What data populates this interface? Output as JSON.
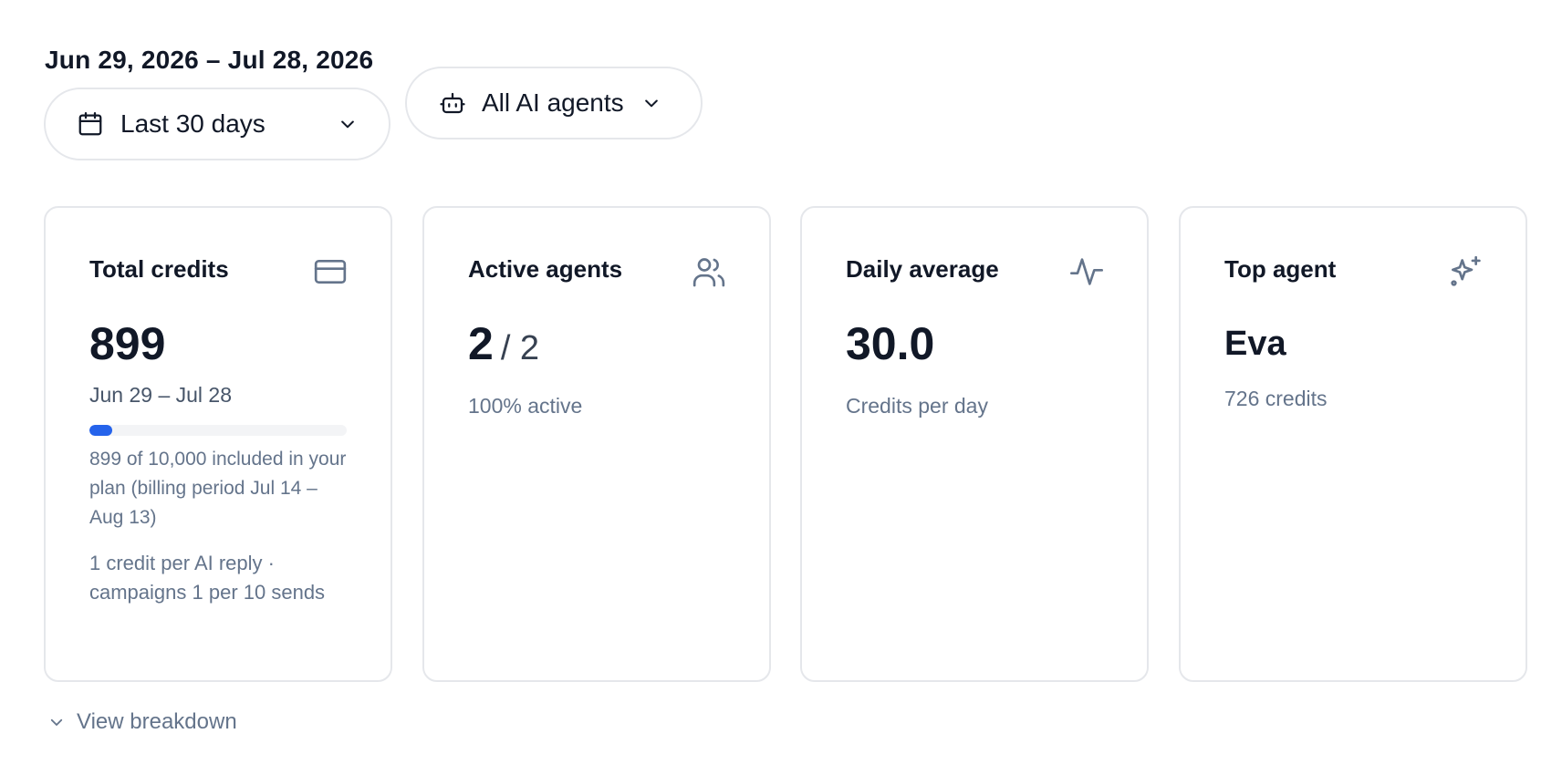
{
  "header": {
    "date_range_title": "Jun 29, 2026 – Jul 28, 2026",
    "range_filter": {
      "label": "Last 30 days",
      "icon": "calendar-icon"
    },
    "agent_filter": {
      "label": "All AI agents",
      "icon": "robot-icon"
    }
  },
  "cards": {
    "total_credits": {
      "title": "Total credits",
      "icon": "credit-card-icon",
      "value": "899",
      "range": "Jun 29 – Jul 28",
      "usage_fraction": 0.0899,
      "usage_note": "899 of 10,000 included in your plan (billing period Jul 14 – Aug 13)",
      "pricing_note": "1 credit per AI reply · campaigns 1 per 10 sends"
    },
    "active_agents": {
      "title": "Active agents",
      "icon": "users-icon",
      "value": "2",
      "separator": "/ 2",
      "note": "100% active"
    },
    "daily_average": {
      "title": "Daily average",
      "icon": "activity-icon",
      "value": "30.0",
      "note": "Credits per day"
    },
    "top_agent": {
      "title": "Top agent",
      "icon": "sparkles-icon",
      "name": "Eva",
      "note": "726 credits"
    }
  },
  "footer": {
    "breakdown_label": "View breakdown"
  },
  "colors": {
    "accent": "#2563eb",
    "border": "#e5e7eb",
    "muted_text": "#64748b",
    "heading_text": "#111827"
  }
}
